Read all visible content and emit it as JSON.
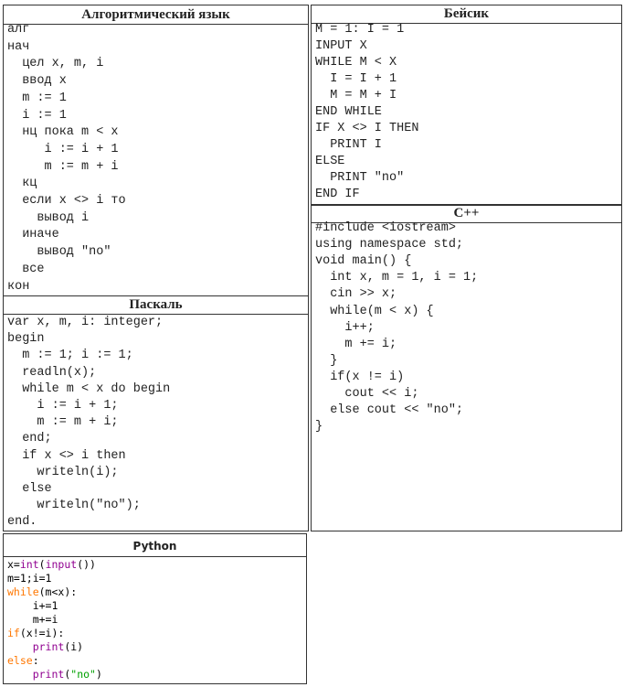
{
  "algo": {
    "title": "Алгоритмический язык",
    "lines": [
      "алг",
      "нач",
      "  цел x, m, i",
      "  ввод x",
      "  m := 1",
      "  i := 1",
      "  нц пока m < x",
      "     i := i + 1",
      "     m := m + i",
      "  кц",
      "  если x <> i то",
      "    вывод i",
      "  иначе",
      "    вывод \"no\"",
      "  все",
      "кон"
    ]
  },
  "pascal": {
    "title": "Паскаль",
    "lines": [
      "var x, m, i: integer;",
      "begin",
      "  m := 1; i := 1;",
      "  readln(x);",
      "  while m < x do begin",
      "    i := i + 1;",
      "    m := m + i;",
      "  end;",
      "  if x <> i then",
      "    writeln(i);",
      "  else",
      "    writeln(\"no\");",
      "end."
    ]
  },
  "basic": {
    "title": "Бейсик",
    "lines": [
      "M = 1: I = 1",
      "INPUT X",
      "WHILE M < X",
      "  I = I + 1",
      "  M = M + I",
      "END WHILE",
      "IF X <> I THEN",
      "  PRINT I",
      "ELSE",
      "  PRINT \"no\"",
      "END IF"
    ]
  },
  "cpp": {
    "title": "C++",
    "lines": [
      "#include <iostream>",
      "using namespace std;",
      "void main() {",
      "  int x, m = 1, i = 1;",
      "  cin >> x;",
      "  while(m < x) {",
      "    i++;",
      "    m += i;",
      "  }",
      "  if(x != i)",
      "    cout << i;",
      "  else cout << \"no\";",
      "}"
    ]
  },
  "python": {
    "title": "Python",
    "colors": {
      "keyword": "#ff7700",
      "builtin": "#900090",
      "string": "#00a000",
      "plain": "#000000"
    },
    "lines": [
      [
        {
          "t": "x=",
          "c": "plain"
        },
        {
          "t": "int",
          "c": "builtin"
        },
        {
          "t": "(",
          "c": "plain"
        },
        {
          "t": "input",
          "c": "builtin"
        },
        {
          "t": "())",
          "c": "plain"
        }
      ],
      [
        {
          "t": "m=1;i=1",
          "c": "plain"
        }
      ],
      [
        {
          "t": "while",
          "c": "keyword"
        },
        {
          "t": "(m<x):",
          "c": "plain"
        }
      ],
      [
        {
          "t": "    i+=1",
          "c": "plain"
        }
      ],
      [
        {
          "t": "    m+=i",
          "c": "plain"
        }
      ],
      [
        {
          "t": "if",
          "c": "keyword"
        },
        {
          "t": "(x!=i):",
          "c": "plain"
        }
      ],
      [
        {
          "t": "    ",
          "c": "plain"
        },
        {
          "t": "print",
          "c": "builtin"
        },
        {
          "t": "(i)",
          "c": "plain"
        }
      ],
      [
        {
          "t": "else",
          "c": "keyword"
        },
        {
          "t": ":",
          "c": "plain"
        }
      ],
      [
        {
          "t": "    ",
          "c": "plain"
        },
        {
          "t": "print",
          "c": "builtin"
        },
        {
          "t": "(",
          "c": "plain"
        },
        {
          "t": "\"no\"",
          "c": "string"
        },
        {
          "t": ")",
          "c": "plain"
        }
      ]
    ]
  }
}
